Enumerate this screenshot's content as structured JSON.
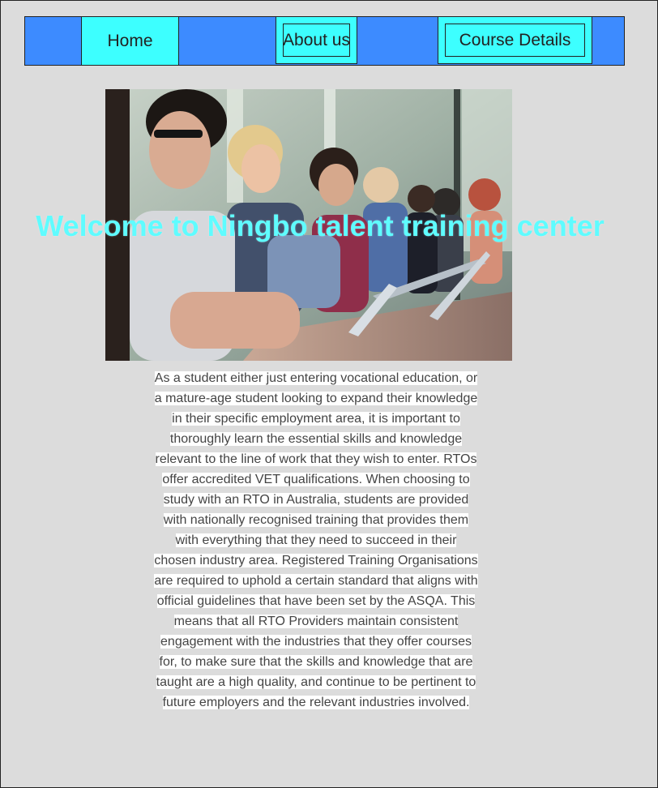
{
  "nav": {
    "home": "Home",
    "about": "About us",
    "course": "Course Details"
  },
  "hero": {
    "title": "Welcome to Ningbo talent training center",
    "image_alt": "Students seated in a row at a lecture desk"
  },
  "content": {
    "paragraph": "As a student either just entering vocational education, or a mature-age student looking to expand their knowledge in their specific employment area, it is important to thoroughly learn the essential skills and knowledge relevant to the line of work that they wish to enter. RTOs offer accredited VET qualifications. When choosing to study with an RTO in Australia, students are provided with nationally recognised training that provides them with everything that they need to succeed in their chosen industry area. Registered Training Organisations are required to uphold a certain standard that aligns with official guidelines that have been set by the ASQA. This means that all RTO Providers maintain consistent engagement with the industries that they offer courses for, to make sure that the skills and knowledge that are taught are a high quality, and continue to be pertinent to future employers and the relevant industries involved."
  },
  "colors": {
    "nav_bg": "#3d8bff",
    "nav_button": "#3dffff",
    "title": "#5ffcff",
    "page_bg": "#dcdcdc"
  }
}
